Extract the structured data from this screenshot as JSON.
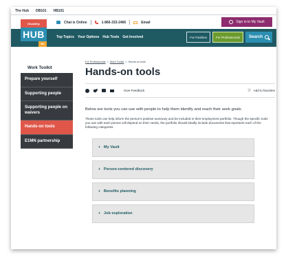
{
  "browser_tabs": [
    "The Hub",
    "DB101",
    "HB101"
  ],
  "utility": {
    "chat_label": "Chat is Online",
    "phone_label": "1-866-333-2466",
    "email_label": "Email",
    "vault_label": "Sign in to My Vault"
  },
  "logo": {
    "top": "Disability",
    "main": "HUB",
    "sub": "MN"
  },
  "nav": {
    "links": [
      "Top Topics",
      "Your Options",
      "Hub Tools",
      "Get Involved"
    ],
    "for_families": "For Families",
    "for_professionals": "For Professionals",
    "search": "Search"
  },
  "sidebar": {
    "title": "Work Toolkit",
    "items": [
      {
        "label": "Prepare yourself"
      },
      {
        "label": "Supporting people"
      },
      {
        "label": "Supporting people on waivers"
      },
      {
        "label": "Hands-on tools"
      },
      {
        "label": "E1MN partnership"
      }
    ]
  },
  "breadcrumb": {
    "crumb1": "For Professionals",
    "crumb2": "Work Toolkit",
    "crumb3": "Hands-on tools",
    "separator": ">"
  },
  "page": {
    "title": "Hands-on tools",
    "feedback": "Give Feedback",
    "favorite": "Add to favorites",
    "intro": "Below are tools you can use with people to help them identify and reach their work goals.",
    "intro2": "These tools can help inform the person's positive summary and be included in their employment portfolio. Though the specific tools you use with each person will depend on their needs, the portfolio should ideally include documents that represent each of the following categories."
  },
  "accordion": {
    "items": [
      {
        "label": "My Vault"
      },
      {
        "label": "Person-centered discovery"
      },
      {
        "label": "Benefits planning"
      },
      {
        "label": "Job exploration"
      }
    ]
  },
  "colors": {
    "nav_bg": "#1f5a63",
    "accent_red": "#e0574a",
    "accent_blue": "#2c8fb2",
    "accent_orange": "#f0a431",
    "vault_purple": "#8d2c6e",
    "pro_green": "#6c9b2d",
    "sidebar_dark": "#373b3f"
  }
}
